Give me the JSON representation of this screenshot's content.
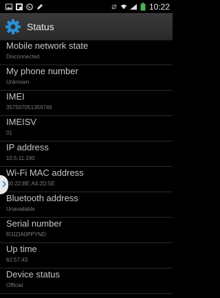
{
  "status_bar": {
    "time": "10:22",
    "left_icons": [
      "gallery-icon",
      "flipboard-icon",
      "whatsapp-icon",
      "pencil-icon"
    ],
    "right_icons": [
      "mute-icon",
      "wifi-icon",
      "signal-icon",
      "battery-icon"
    ]
  },
  "header": {
    "title": "Status"
  },
  "items": [
    {
      "label": "Mobile network state",
      "value": "Disconnected"
    },
    {
      "label": "My phone number",
      "value": "Unknown"
    },
    {
      "label": "IMEI",
      "value": "357507051359746"
    },
    {
      "label": "IMEISV",
      "value": "01"
    },
    {
      "label": "IP address",
      "value": "10.5.11.190"
    },
    {
      "label": "Wi-Fi MAC address",
      "value": "D0:22:BE:A4:2D:5E"
    },
    {
      "label": "Bluetooth address",
      "value": "Unavailable"
    },
    {
      "label": "Serial number",
      "value": "R31DA0PPYND"
    },
    {
      "label": "Up time",
      "value": "62:57:43"
    },
    {
      "label": "Device status",
      "value": "Official"
    }
  ],
  "colors": {
    "accent": "#2a8fd8",
    "background": "#000000",
    "action_bar": "#2f2f2f"
  }
}
